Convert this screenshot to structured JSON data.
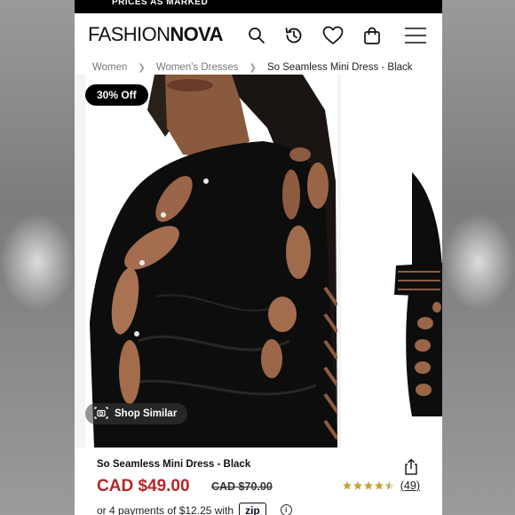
{
  "promo": {
    "text": "PRICES AS MARKED"
  },
  "header": {
    "logo_thin": "FASHION",
    "logo_bold": "NOVA",
    "icons": [
      "search-icon",
      "history-icon",
      "heart-icon",
      "bag-icon",
      "menu-icon"
    ]
  },
  "breadcrumb": {
    "items": [
      "Women",
      "Women's Dresses",
      "So Seamless Mini Dress - Black"
    ]
  },
  "gallery": {
    "discount_badge": "30% Off",
    "shop_similar_label": "Shop Similar"
  },
  "product": {
    "name": "So Seamless Mini Dress - Black",
    "price": "CAD $49.00",
    "original_price": "CAD $70.00",
    "rating_stars": 4.5,
    "rating_count": "(49)",
    "installments_text": "or 4 payments of $12.25 with",
    "installment_provider": "zip"
  },
  "colors": {
    "price_red": "#b3262b",
    "star_gold": "#c8a33a",
    "black": "#000000"
  }
}
